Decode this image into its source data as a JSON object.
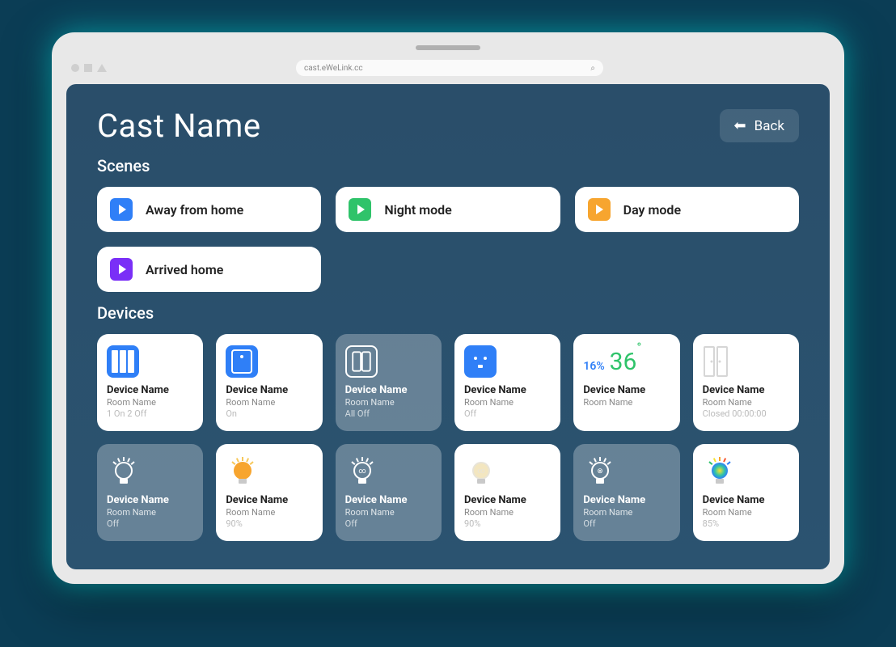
{
  "browser": {
    "url": "cast.eWeLink.cc"
  },
  "header": {
    "title": "Cast Name",
    "back_label": "Back"
  },
  "sections": {
    "scenes_title": "Scenes",
    "devices_title": "Devices"
  },
  "scenes": [
    {
      "label": "Away from home",
      "color": "#2f7ff7"
    },
    {
      "label": "Night mode",
      "color": "#2fc36a"
    },
    {
      "label": "Day mode",
      "color": "#f7a52f"
    },
    {
      "label": "Arrived home",
      "color": "#7a2ff7"
    }
  ],
  "devices": [
    {
      "icon": "locker",
      "variant": "light",
      "name": "Device Name",
      "room": "Room Name",
      "status": "1 On 2 Off"
    },
    {
      "icon": "switch",
      "variant": "light",
      "name": "Device Name",
      "room": "Room Name",
      "status": "On"
    },
    {
      "icon": "switch-dual",
      "variant": "dim",
      "name": "Device Name",
      "room": "Room Name",
      "status": "All Off"
    },
    {
      "icon": "outlet",
      "variant": "light",
      "name": "Device Name",
      "room": "Room Name",
      "status": "Off"
    },
    {
      "icon": "thermo",
      "variant": "light",
      "name": "Device Name",
      "room": "Room Name",
      "status": "",
      "humidity": "16%",
      "temperature": "36",
      "degree": "°"
    },
    {
      "icon": "door",
      "variant": "light",
      "name": "Device Name",
      "room": "Room Name",
      "status": "Closed 00:00:00"
    },
    {
      "icon": "bulb-off",
      "variant": "dim",
      "name": "Device Name",
      "room": "Room Name",
      "status": "Off"
    },
    {
      "icon": "bulb-orange",
      "variant": "light",
      "name": "Device Name",
      "room": "Room Name",
      "status": "90%"
    },
    {
      "icon": "bulb-ring",
      "variant": "dim",
      "name": "Device Name",
      "room": "Room Name",
      "status": "Off"
    },
    {
      "icon": "bulb-warm",
      "variant": "light",
      "name": "Device Name",
      "room": "Room Name",
      "status": "90%"
    },
    {
      "icon": "bulb-cool",
      "variant": "dim",
      "name": "Device Name",
      "room": "Room Name",
      "status": "Off"
    },
    {
      "icon": "bulb-rgb",
      "variant": "light",
      "name": "Device Name",
      "room": "Room Name",
      "status": "85%"
    }
  ]
}
